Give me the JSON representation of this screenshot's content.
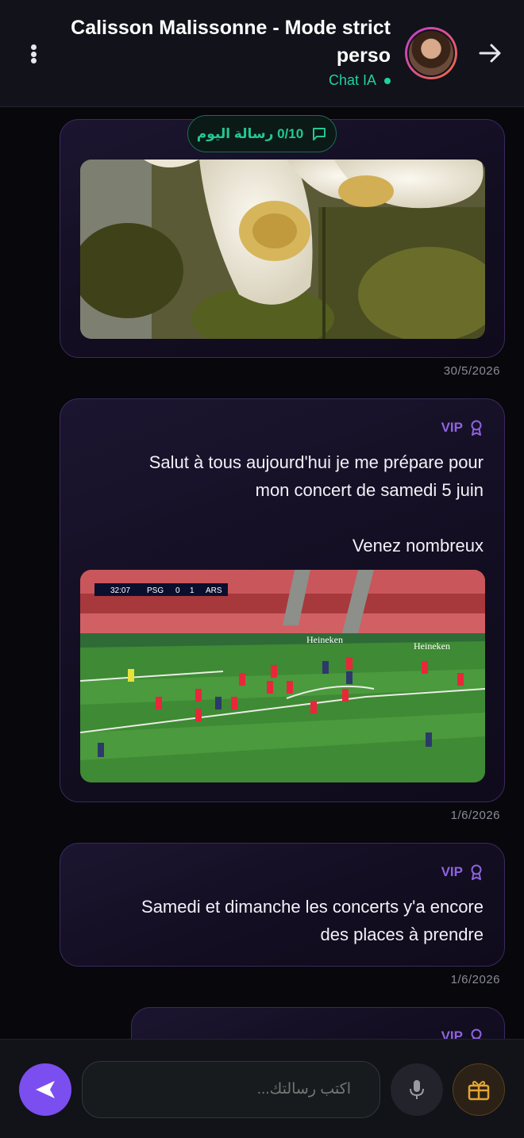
{
  "header": {
    "title": "Calisson Malissonne - Mode strict perso",
    "status": "Chat IA",
    "status_color": "#1fd1a1"
  },
  "counter": {
    "text": "0/10 رسالة اليوم",
    "icon": "message-square-icon"
  },
  "messages": [
    {
      "type": "image",
      "image_description_icon": "flower-photo",
      "timestamp": "30/5/2026"
    },
    {
      "badge": "VIP",
      "badge_icon": "award-icon",
      "text": "Salut à tous aujourd'hui je me prépare pour\nmon concert de samedi 5 juin\n\nVenez nombreux",
      "image_icon": "football-match-photo",
      "scoreboard": {
        "time": "32:07",
        "home": "PSG",
        "home_score": "0",
        "away_score": "1",
        "away": "ARS"
      },
      "ad_text": "Heineken",
      "timestamp": "1/6/2026"
    },
    {
      "badge": "VIP",
      "badge_icon": "award-icon",
      "text": "Samedi et dimanche les concerts y'a encore\ndes places à prendre",
      "timestamp": "1/6/2026"
    },
    {
      "badge": "VIP",
      "badge_icon": "award-icon"
    }
  ],
  "composer": {
    "placeholder": "اكتب رسالتك...",
    "send_icon": "send-icon",
    "mic_icon": "microphone-icon",
    "gift_icon": "gift-icon"
  },
  "colors": {
    "accent": "#7b4ef0",
    "vip": "#8e63e0",
    "counter": "#22c793",
    "gift": "#e3a534"
  }
}
